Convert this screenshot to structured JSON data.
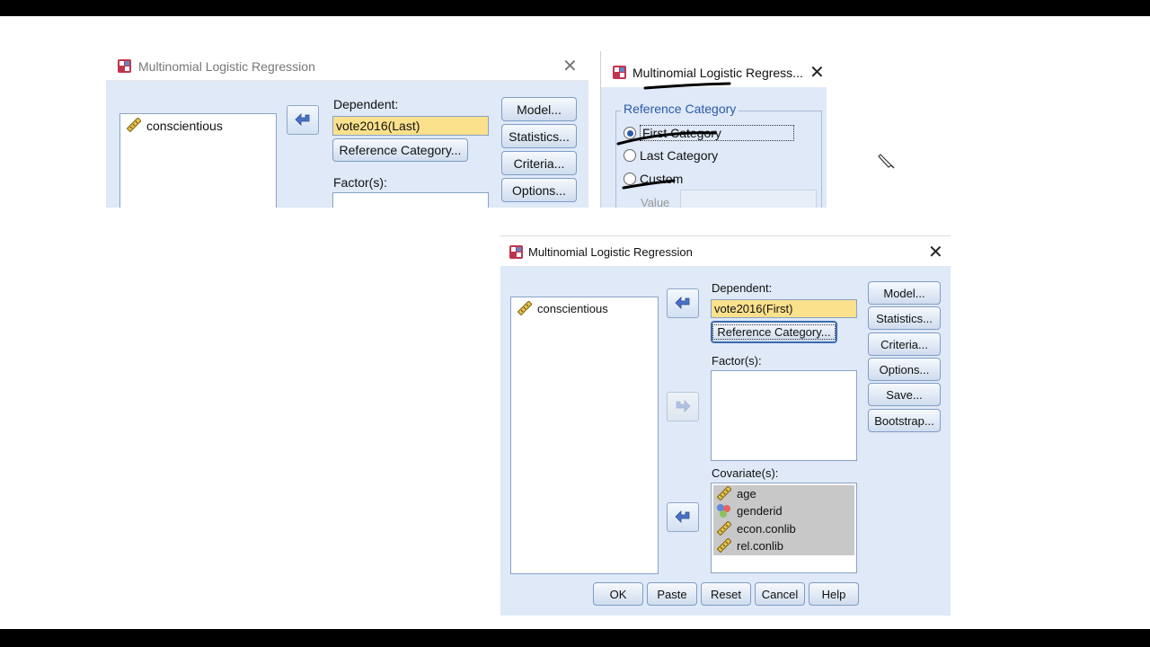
{
  "dialog_back": {
    "title": "Multinomial Logistic Regression",
    "variables": [
      "conscientious"
    ],
    "dependent_label": "Dependent:",
    "dependent_value": "vote2016(Last)",
    "ref_button": "Reference Category...",
    "factors_label": "Factor(s):",
    "buttons": [
      "Model...",
      "Statistics...",
      "Criteria...",
      "Options..."
    ]
  },
  "ref_dialog": {
    "title": "Multinomial Logistic Regress...",
    "group_label": "Reference Category",
    "options": [
      "First Category",
      "Last Category",
      "Custom"
    ],
    "selected": "First Category",
    "value_label": "Value"
  },
  "dialog_front": {
    "title": "Multinomial Logistic Regression",
    "variables": [
      "conscientious"
    ],
    "dependent_label": "Dependent:",
    "dependent_value": "vote2016(First)",
    "ref_button": "Reference Category...",
    "factors_label": "Factor(s):",
    "covariates_label": "Covariate(s):",
    "covariates": [
      "age",
      "genderid",
      "econ.conlib",
      "rel.conlib"
    ],
    "side_buttons": [
      "Model...",
      "Statistics...",
      "Criteria...",
      "Options...",
      "Save...",
      "Bootstrap..."
    ],
    "bottom_buttons": [
      "OK",
      "Paste",
      "Reset",
      "Cancel",
      "Help"
    ]
  },
  "colors": {
    "dialog_bg": "#dfe9f7",
    "dependent_highlight": "#fbe18c",
    "group_title": "#2a5aa8",
    "selection_grey": "#c8c8c8"
  },
  "icons": [
    "app-icon",
    "ruler-scale-icon",
    "nominal-circles-icon",
    "arrow-right-icon",
    "close-icon",
    "pen-cursor-icon"
  ]
}
